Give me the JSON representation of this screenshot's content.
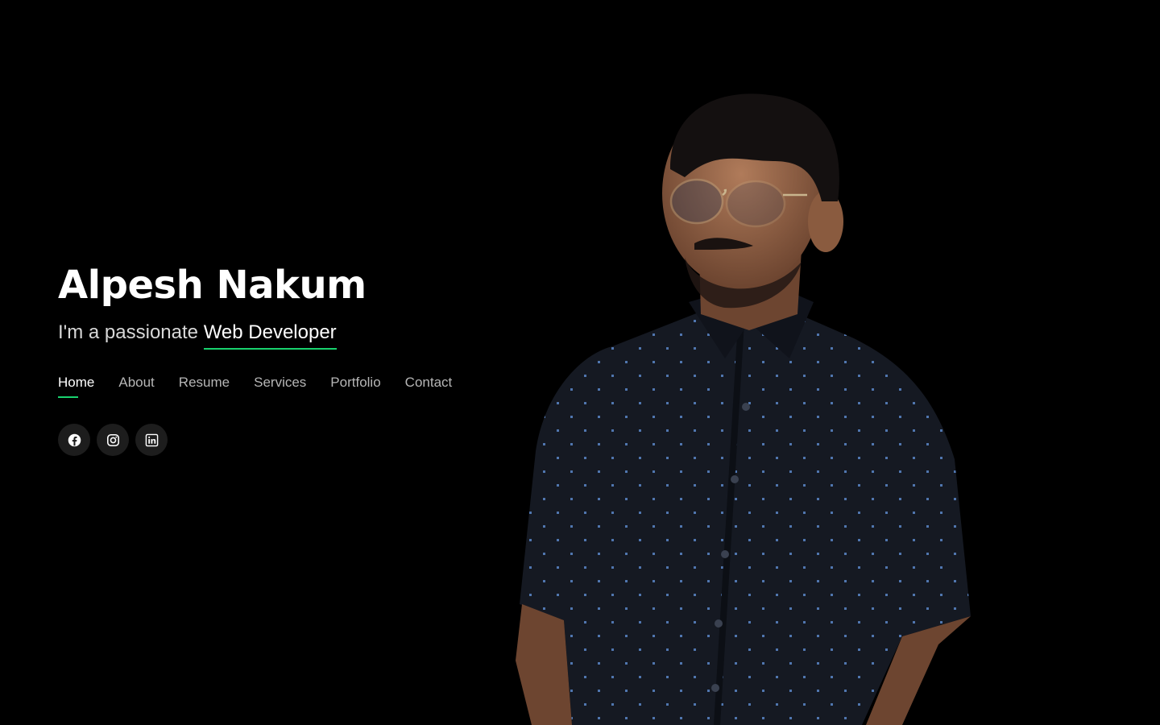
{
  "hero": {
    "name": "Alpesh Nakum",
    "tagline_prefix": "I'm a passionate ",
    "tagline_role": "Web Developer"
  },
  "nav": {
    "items": [
      {
        "label": "Home",
        "active": true
      },
      {
        "label": "About",
        "active": false
      },
      {
        "label": "Resume",
        "active": false
      },
      {
        "label": "Services",
        "active": false
      },
      {
        "label": "Portfolio",
        "active": false
      },
      {
        "label": "Contact",
        "active": false
      }
    ]
  },
  "social": {
    "icons": [
      "facebook-icon",
      "instagram-icon",
      "linkedin-icon"
    ]
  },
  "colors": {
    "background": "#000000",
    "accent": "#18d26e",
    "nav_inactive": "#b6b6b6",
    "social_button_bg": "#1d1d1d"
  }
}
